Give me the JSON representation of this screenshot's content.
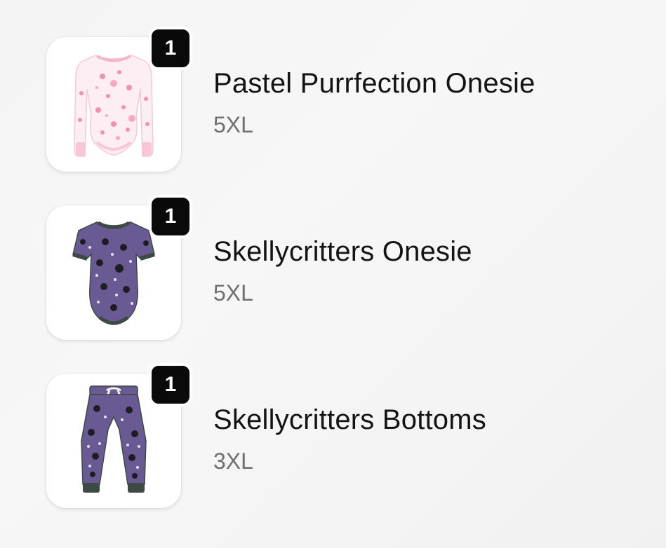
{
  "cart": {
    "items": [
      {
        "name": "Pastel Purrfection Onesie",
        "size": "5XL",
        "quantity": "1",
        "image_icon": "long-sleeve-onesie-icon",
        "colors": {
          "primary": "#fbe3ec",
          "accent": "#f48fb1",
          "trim": "#f8c6d6"
        }
      },
      {
        "name": "Skellycritters Onesie",
        "size": "5XL",
        "quantity": "1",
        "image_icon": "short-sleeve-onesie-icon",
        "colors": {
          "primary": "#6a5a93",
          "accent": "#1f1d24",
          "trim": "#3d4a44"
        }
      },
      {
        "name": "Skellycritters Bottoms",
        "size": "3XL",
        "quantity": "1",
        "image_icon": "jogger-bottoms-icon",
        "colors": {
          "primary": "#6a5a93",
          "accent": "#1f1d24",
          "trim": "#3d4a44"
        }
      }
    ]
  }
}
